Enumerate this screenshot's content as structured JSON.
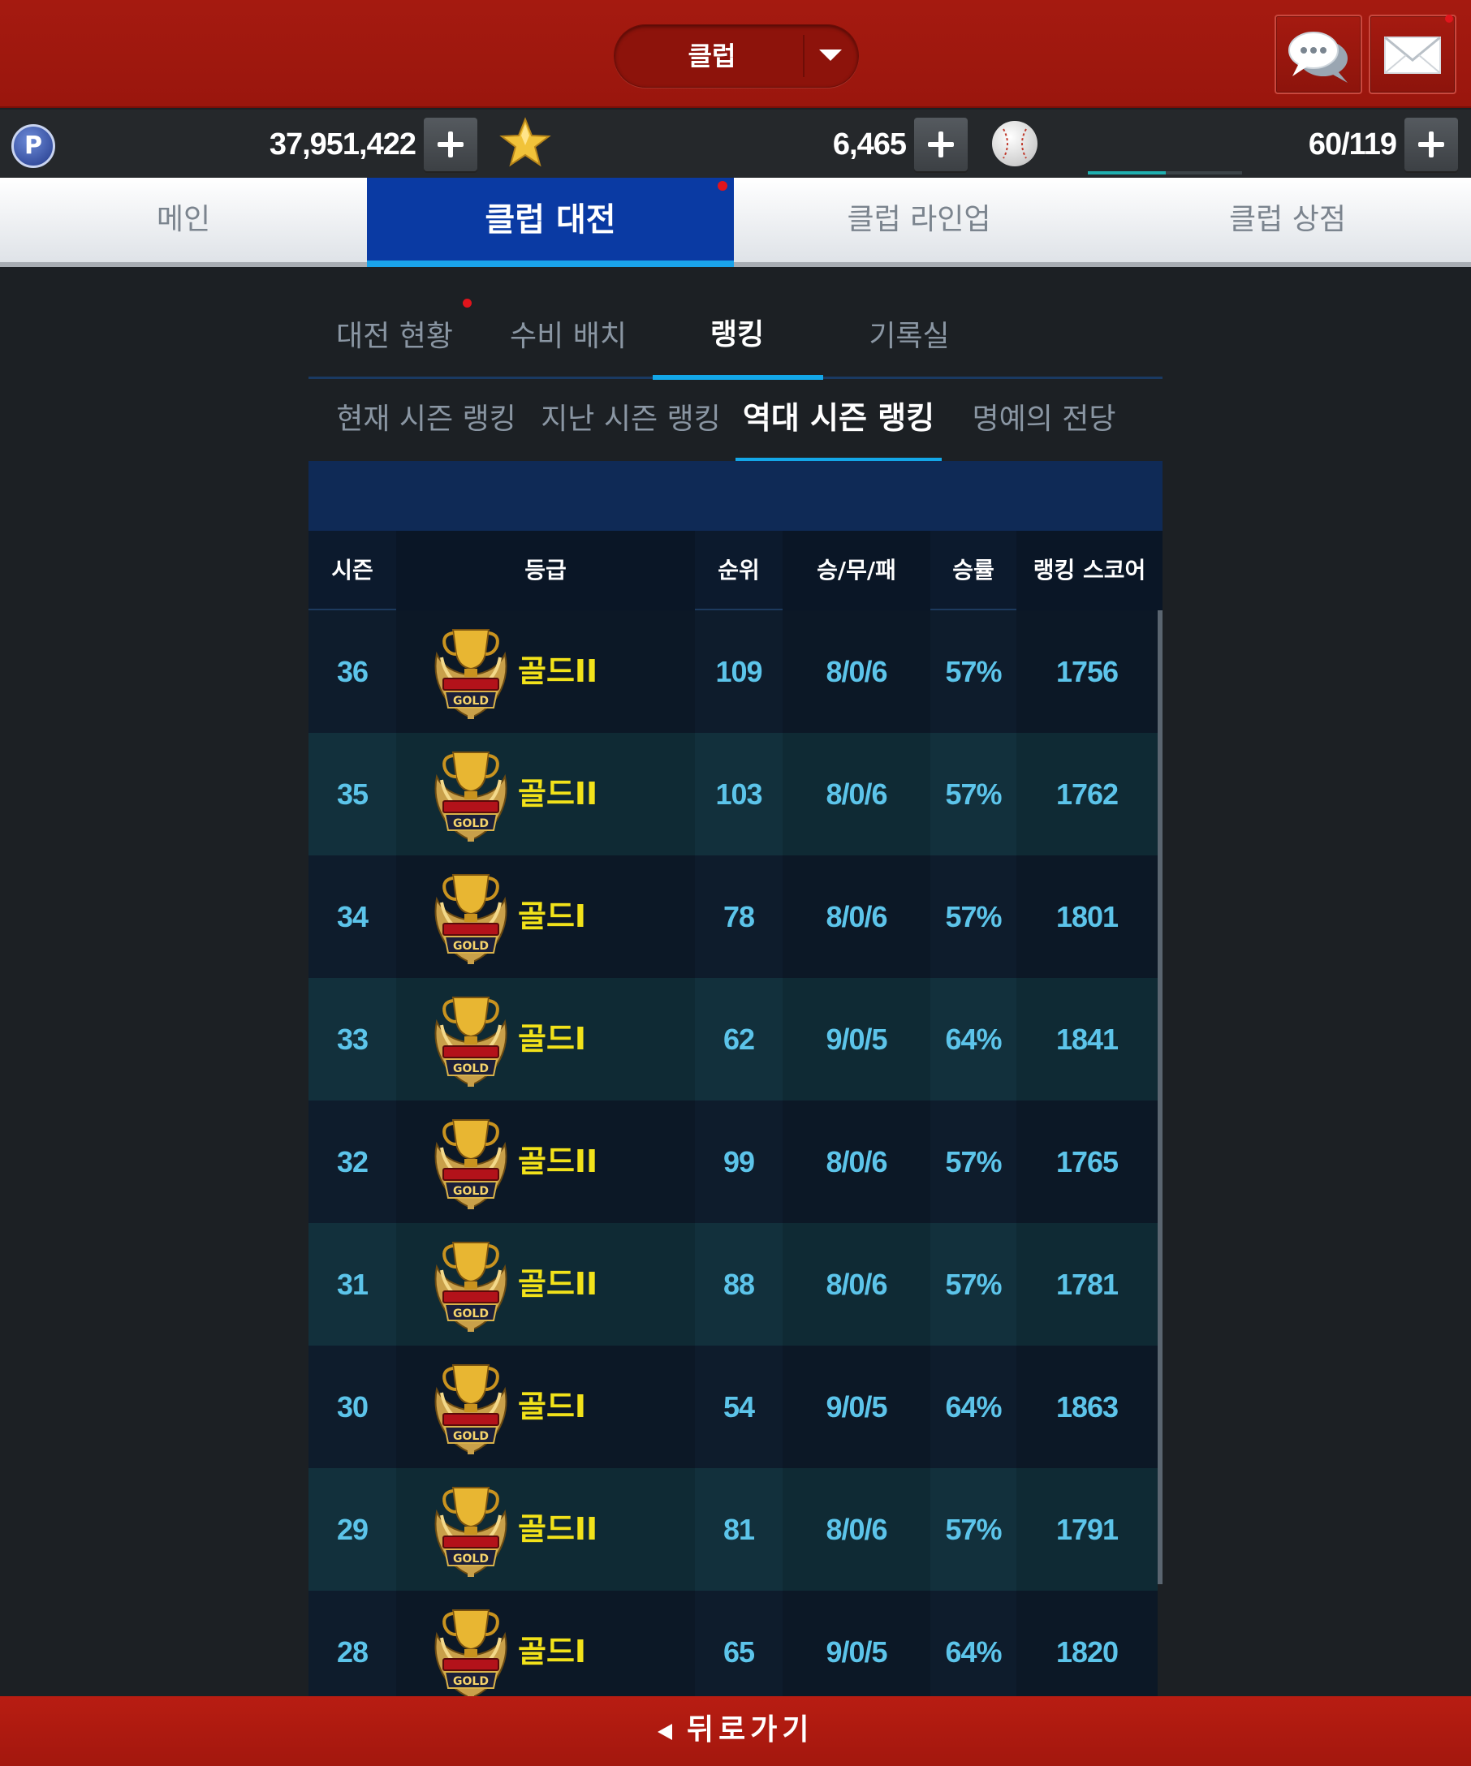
{
  "header": {
    "club_select_label": "클럽",
    "chat_icon": "chat-bubbles-icon",
    "mail_icon": "envelope-icon",
    "colors": {
      "bar": "#a51a10"
    }
  },
  "currency": {
    "points": "37,951,422",
    "stars": "6,465",
    "stamina": "60/119",
    "stamina_fraction": 0.504
  },
  "main_tabs": [
    {
      "label": "메인"
    },
    {
      "label": "클럽 대전",
      "active": true
    },
    {
      "label": "클럽 라인업"
    },
    {
      "label": "클럽 상점"
    }
  ],
  "sub_tabs": [
    {
      "label": "대전 현황"
    },
    {
      "label": "수비 배치"
    },
    {
      "label": "랭킹",
      "active": true
    },
    {
      "label": "기록실"
    }
  ],
  "ranking_tabs": [
    {
      "label": "현재 시즌 랭킹"
    },
    {
      "label": "지난 시즌 랭킹"
    },
    {
      "label": "역대 시즌 랭킹",
      "active": true
    },
    {
      "label": "명예의 전당"
    }
  ],
  "table": {
    "headers": [
      "시즌",
      "등급",
      "순위",
      "승/무/패",
      "승률",
      "랭킹 스코어"
    ],
    "rows": [
      {
        "season": "36",
        "grade": "골드II",
        "rank": "109",
        "record": "8/0/6",
        "winrate": "57%",
        "score": "1756"
      },
      {
        "season": "35",
        "grade": "골드II",
        "rank": "103",
        "record": "8/0/6",
        "winrate": "57%",
        "score": "1762"
      },
      {
        "season": "34",
        "grade": "골드I",
        "rank": "78",
        "record": "8/0/6",
        "winrate": "57%",
        "score": "1801"
      },
      {
        "season": "33",
        "grade": "골드I",
        "rank": "62",
        "record": "9/0/5",
        "winrate": "64%",
        "score": "1841"
      },
      {
        "season": "32",
        "grade": "골드II",
        "rank": "99",
        "record": "8/0/6",
        "winrate": "57%",
        "score": "1765"
      },
      {
        "season": "31",
        "grade": "골드II",
        "rank": "88",
        "record": "8/0/6",
        "winrate": "57%",
        "score": "1781"
      },
      {
        "season": "30",
        "grade": "골드I",
        "rank": "54",
        "record": "9/0/5",
        "winrate": "64%",
        "score": "1863"
      },
      {
        "season": "29",
        "grade": "골드II",
        "rank": "81",
        "record": "8/0/6",
        "winrate": "57%",
        "score": "1791"
      },
      {
        "season": "28",
        "grade": "골드I",
        "rank": "65",
        "record": "9/0/5",
        "winrate": "64%",
        "score": "1820"
      }
    ],
    "emblem_text": "GOLD"
  },
  "footer": {
    "back_label": "뒤로가기"
  }
}
